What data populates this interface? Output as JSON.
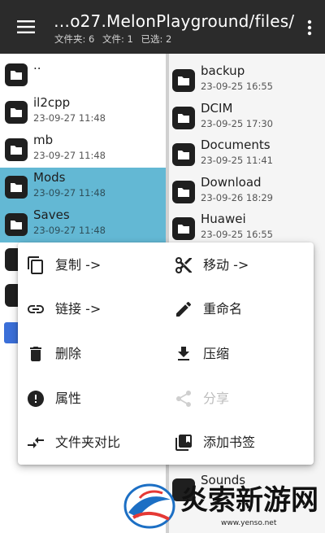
{
  "header": {
    "path_title": "…o27.MelonPlayground/files/",
    "folders_label": "文件夹: 6",
    "files_label": "文件: 1",
    "selected_label": "已选: 2"
  },
  "left_pane": {
    "items": [
      {
        "name": "..",
        "date": "",
        "selected": false
      },
      {
        "name": "il2cpp",
        "date": "23-09-27 11:48",
        "selected": false
      },
      {
        "name": "mb",
        "date": "23-09-27 11:48",
        "selected": false
      },
      {
        "name": "Mods",
        "date": "23-09-27 11:48",
        "selected": true
      },
      {
        "name": "Saves",
        "date": "23-09-27 11:48",
        "selected": true
      }
    ]
  },
  "right_pane": {
    "items": [
      {
        "name": "backup",
        "date": "23-09-25 16:55"
      },
      {
        "name": "DCIM",
        "date": "23-09-25 17:30"
      },
      {
        "name": "Documents",
        "date": "23-09-25 11:41"
      },
      {
        "name": "Download",
        "date": "23-09-26 18:29"
      },
      {
        "name": "Huawei",
        "date": "23-09-25 16:55"
      }
    ],
    "peek_item": "Sounds"
  },
  "context_menu": {
    "copy": "复制 ->",
    "move": "移动 ->",
    "link": "链接 ->",
    "rename": "重命名",
    "delete": "删除",
    "compress": "压缩",
    "properties": "属性",
    "share": "分享",
    "compare": "文件夹对比",
    "bookmark": "添加书签"
  },
  "watermark": {
    "text": "炎索新游网",
    "url": "www.yenso.net"
  },
  "icons": {
    "menu": "hamburger-menu-icon",
    "more": "more-vert-icon",
    "folder": "folder-icon",
    "copy": "copy-icon",
    "move": "scissors-icon",
    "link": "link-icon",
    "rename": "pencil-icon",
    "delete": "trash-icon",
    "compress": "download-arrow-icon",
    "properties": "info-icon",
    "share": "share-icon",
    "compare": "compare-arrows-icon",
    "bookmark": "bookmark-library-icon"
  },
  "colors": {
    "topbar": "#2b2b2b",
    "selection": "#63b8d4",
    "folder": "#1f1f1f",
    "disabled": "#bdbdbd"
  }
}
